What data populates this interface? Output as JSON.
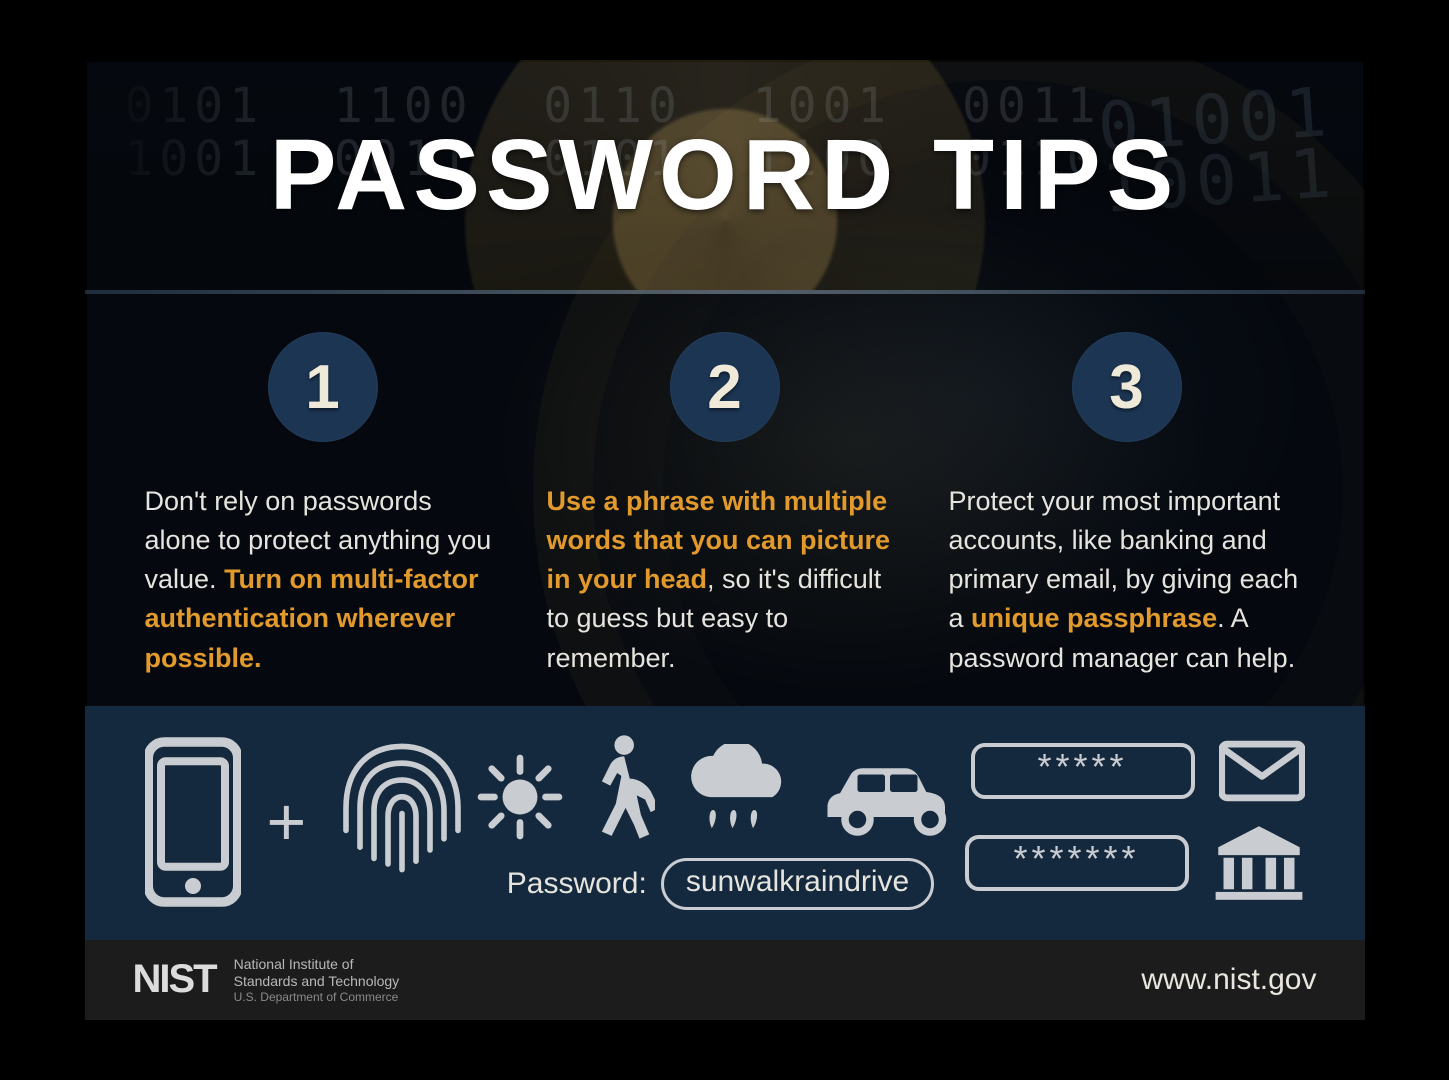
{
  "title": "PASSWORD TIPS",
  "accent_color": "#e29a2d",
  "tips": [
    {
      "num": "1",
      "lead": "Don't rely on passwords alone to protect anything you value. ",
      "em": "Turn on multi-factor authentication wherever possible.",
      "tail": ""
    },
    {
      "num": "2",
      "lead": "",
      "em": "Use a phrase with multiple words that you can picture in your head",
      "tail": ", so it's difficult to guess but easy to remember."
    },
    {
      "num": "3",
      "lead": "Protect your most important accounts, like banking and primary email, by giving each a ",
      "em": "unique passphrase",
      "tail": ". A password manager can help."
    }
  ],
  "example": {
    "label": "Password:",
    "value": "sunwalkraindrive",
    "icons": [
      "sun-icon",
      "walker-icon",
      "raincloud-icon",
      "car-icon"
    ]
  },
  "mfa_icons": [
    "phone-icon",
    "plus",
    "fingerprint-icon"
  ],
  "unique": {
    "mask1": "*****",
    "mask2": "*******",
    "icons": [
      "mail-icon",
      "bank-icon"
    ]
  },
  "footer": {
    "logo": "NIST",
    "org1": "National Institute of",
    "org2": "Standards and Technology",
    "dept": "U.S. Department of Commerce",
    "url": "www.nist.gov"
  }
}
